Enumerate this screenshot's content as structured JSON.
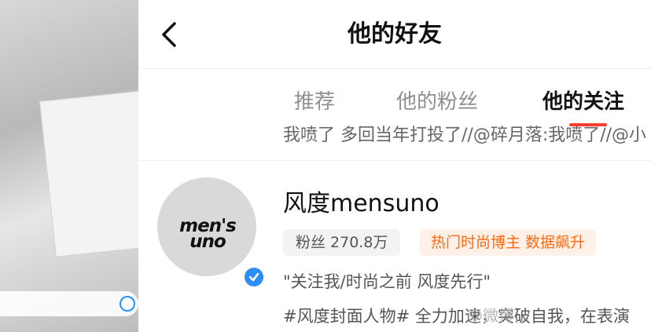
{
  "header": {
    "title": "他的好友"
  },
  "tabs": [
    {
      "label": "推荐",
      "active": false
    },
    {
      "label": "他的粉丝",
      "active": false
    },
    {
      "label": "他的关注",
      "active": true
    }
  ],
  "previous_item": {
    "snippet": "我喷了 多回当年打投了//@碎月落:我喷了//@小"
  },
  "user": {
    "name": "风度mensuno",
    "avatar_logo_line1": "men's",
    "avatar_logo_line2": "uno",
    "fans_label": "粉丝 270.8万",
    "tag_label": "热门时尚博主 数据飙升",
    "bio_line1": "\"关注我/时尚之前 风度先行\"",
    "bio_line2": "#风度封面人物# 全力加速，突破自我，在表演",
    "verified": true
  },
  "watermark": "@微博…",
  "colors": {
    "accent": "#ff3b30",
    "verified": "#2c8ef8",
    "tag_text": "#ff6a13",
    "tag_bg": "#fff1e8"
  },
  "icons": {
    "back": "chevron-left-icon",
    "verified": "verified-badge-icon"
  }
}
